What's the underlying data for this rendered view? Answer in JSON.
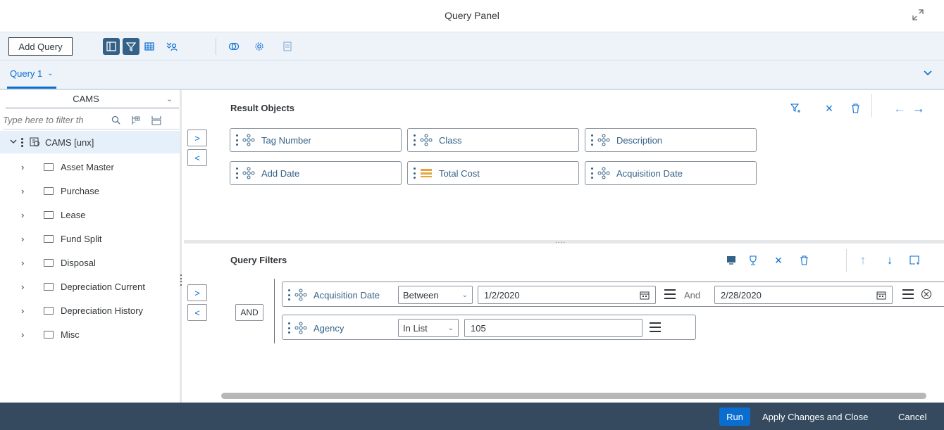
{
  "title": "Query Panel",
  "toolbar": {
    "add_query": "Add Query"
  },
  "query_tab": {
    "label": "Query 1"
  },
  "left": {
    "universe": "CAMS",
    "filter_placeholder": "Type here to filter th",
    "root_label": "CAMS [unx]",
    "folders": [
      "Asset Master",
      "Purchase",
      "Lease",
      "Fund Split",
      "Disposal",
      "Depreciation Current",
      "Depreciation History",
      "Misc"
    ]
  },
  "results": {
    "title": "Result Objects",
    "objects": [
      "Tag Number",
      "Class",
      "Description",
      "Add Date",
      "Total Cost",
      "Acquisition Date"
    ]
  },
  "filters": {
    "title": "Query Filters",
    "and_label": "AND",
    "row1": {
      "object": "Acquisition Date",
      "operator": "Between",
      "value1": "1/2/2020",
      "and_label": "And",
      "value2": "2/28/2020"
    },
    "row2": {
      "object": "Agency",
      "operator": "In List",
      "value": "105"
    }
  },
  "footer": {
    "run": "Run",
    "apply": "Apply Changes and Close",
    "cancel": "Cancel"
  },
  "colors": {
    "accent": "#0a6ed1",
    "footer_bg": "#354a5f",
    "toolbar_bg": "#edf3f8",
    "active_icon_bg": "#346187"
  }
}
